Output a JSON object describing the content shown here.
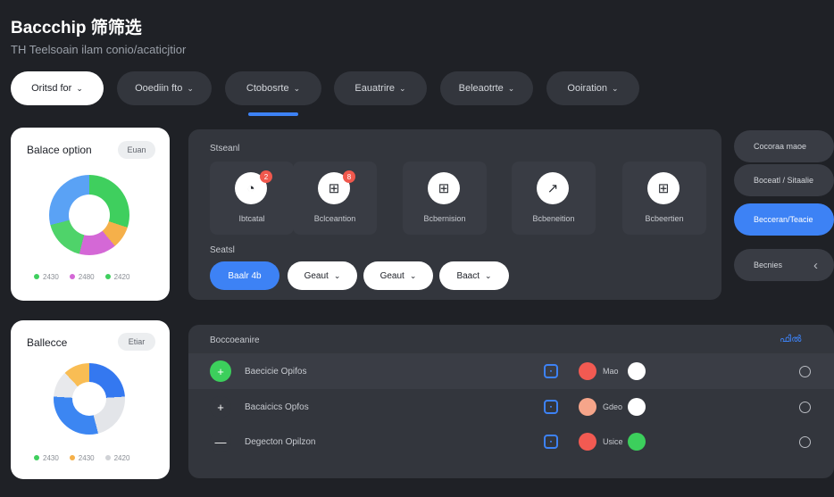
{
  "header": {
    "title": "Baccchip 筛筛选",
    "subtitle": "TH Teelsoain ilam conio/acaticjtior"
  },
  "filters": [
    {
      "label": "Oritsd for",
      "selected": true
    },
    {
      "label": "Ooediin fto",
      "selected": false
    },
    {
      "label": "Ctobosrte",
      "selected": false
    },
    {
      "label": "Eauatrire",
      "selected": false
    },
    {
      "label": "Beleaotrte",
      "selected": false
    },
    {
      "label": "Ooiration",
      "selected": false
    }
  ],
  "chevron": "⌄",
  "card1": {
    "title": "Balace option",
    "chip": "Euan",
    "legend": [
      "2430",
      "2480",
      "2420"
    ],
    "chart_data": {
      "type": "pie",
      "slices": [
        {
          "color": "#3fcf5e",
          "value": 30
        },
        {
          "color": "#f5b04a",
          "value": 9
        },
        {
          "color": "#d468d6",
          "value": 15
        },
        {
          "color": "#4fd36a",
          "value": 17
        },
        {
          "color": "#5aa2f5",
          "value": 29
        }
      ]
    }
  },
  "card2": {
    "title": "Ballecce",
    "chip": "Etiar",
    "legend": [
      "2430",
      "2430",
      "2420"
    ],
    "chart_data": {
      "type": "pie",
      "slices": [
        {
          "color": "#3478f0",
          "value": 24
        },
        {
          "color": "#e3e5e9",
          "value": 22
        },
        {
          "color": "#3c86f2",
          "value": 30
        },
        {
          "color": "#e8e9ec",
          "value": 12
        },
        {
          "color": "#f9bd54",
          "value": 12
        }
      ]
    }
  },
  "selection_panel": {
    "heading": "Stseanl",
    "tiles": [
      {
        "label": "Ibtcatal",
        "icon": "◔",
        "badge": "2"
      },
      {
        "label": "Bclceantion",
        "icon": "⊞",
        "badge": "8"
      },
      {
        "label": "Bcbernision",
        "icon": "⊞",
        "badge": ""
      },
      {
        "label": "Bcbeneition",
        "icon": "↗",
        "badge": ""
      },
      {
        "label": "Bcbeertien",
        "icon": "⊞",
        "badge": ""
      }
    ],
    "sub_heading": "Seatsl",
    "buttons": [
      {
        "label": "Baalr 4b",
        "style": "blue"
      },
      {
        "label": "Geaut",
        "style": "white"
      },
      {
        "label": "Geaut",
        "style": "white"
      },
      {
        "label": "Baact",
        "style": "white"
      }
    ]
  },
  "right_actions": [
    {
      "label": "Cocoraa maoe",
      "style": "dark"
    },
    {
      "label": "Boceatl / Sitaalie",
      "style": "dark"
    },
    {
      "label": "Becceran/Teacie",
      "style": "blue"
    },
    {
      "label": "Becnies",
      "style": "dark",
      "icon": "‹"
    }
  ],
  "list_panel": {
    "heading": "Boccoeanire",
    "corner": "ഫിൽ",
    "rows": [
      {
        "icon": "+",
        "icon_color": "#3ccf5c",
        "label": "Baecicie Opifos",
        "swatch": "#f25a52",
        "tag": "Mao",
        "toggle": "#ffffff"
      },
      {
        "icon": "+",
        "icon_color": "#33363d",
        "label": "Bacaicics Opfos",
        "swatch": "#f6a58a",
        "tag": "Gdeo",
        "toggle": "#ffffff"
      },
      {
        "icon": "—",
        "icon_color": "#33363d",
        "label": "Degecton Opilzon",
        "swatch": "#f25a52",
        "tag": "Usice",
        "toggle": "#3ccf5c"
      }
    ]
  }
}
